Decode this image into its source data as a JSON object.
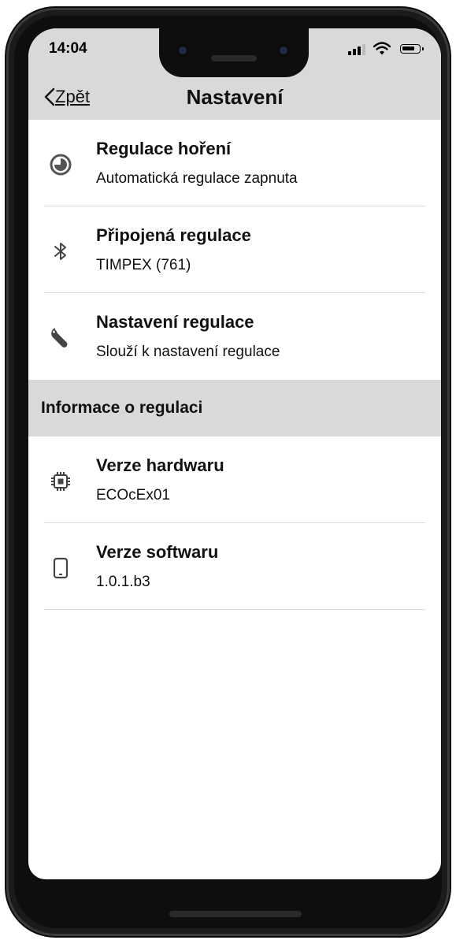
{
  "status_bar": {
    "time": "14:04"
  },
  "nav": {
    "back_label": "Zpět",
    "title": "Nastavení"
  },
  "items": [
    {
      "title": "Regulace hoření",
      "subtitle": "Automatická regulace zapnuta",
      "icon": "burn-control-icon"
    },
    {
      "title": "Připojená regulace",
      "subtitle": "TIMPEX (761)",
      "icon": "bluetooth-icon"
    },
    {
      "title": "Nastavení regulace",
      "subtitle": "Slouží k nastavení regulace",
      "icon": "wrench-icon"
    }
  ],
  "section": {
    "label": "Informace o regulaci"
  },
  "info_items": [
    {
      "title": "Verze hardwaru",
      "subtitle": "ECOcEx01",
      "icon": "chip-icon"
    },
    {
      "title": "Verze softwaru",
      "subtitle": "1.0.1.b3",
      "icon": "phone-icon"
    }
  ]
}
